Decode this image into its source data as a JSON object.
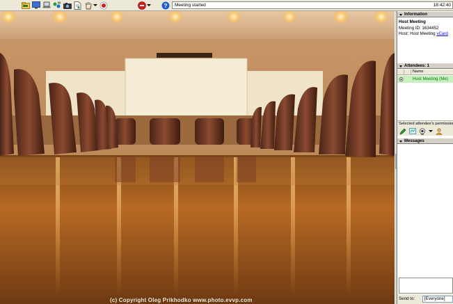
{
  "toolbar": {
    "status_text": "Meeting started",
    "clock": "18:42:40"
  },
  "video": {
    "copyright": "(c) Copyright Oleg Prikhodko   www.photo.evvp.com"
  },
  "sections": {
    "information": "Information",
    "attendees": "Attendees: 1",
    "messages": "Messages"
  },
  "info": {
    "title": "Host Meeting",
    "meeting_id": "Meeting ID: 1634452",
    "host_prefix": "Host: Host Meeting",
    "vcard": "vCard"
  },
  "attendees": {
    "column_name": "Name",
    "rows": [
      {
        "name": "Host Meeting (Me)"
      }
    ]
  },
  "permissions_label": "Selected attendee's permissions",
  "send": {
    "label": "Send to:",
    "value": "[Everyone]"
  },
  "icons": {
    "toolbar": [
      "folder-icon",
      "monitor-icon",
      "laptop-icon",
      "share-icon",
      "camera-icon",
      "document-icon",
      "hand-icon",
      "record-icon",
      "stop-icon",
      "help-icon"
    ],
    "permissions": [
      "pen-icon",
      "whiteboard-icon",
      "webcam-icon",
      "user-icon"
    ]
  },
  "colors": {
    "toolbar_bg": "#ece9d8",
    "panel_bg": "#d4d0c8",
    "attendee_highlight": "#c8f0c0",
    "attendee_text": "#008000",
    "link": "#0000ee"
  }
}
